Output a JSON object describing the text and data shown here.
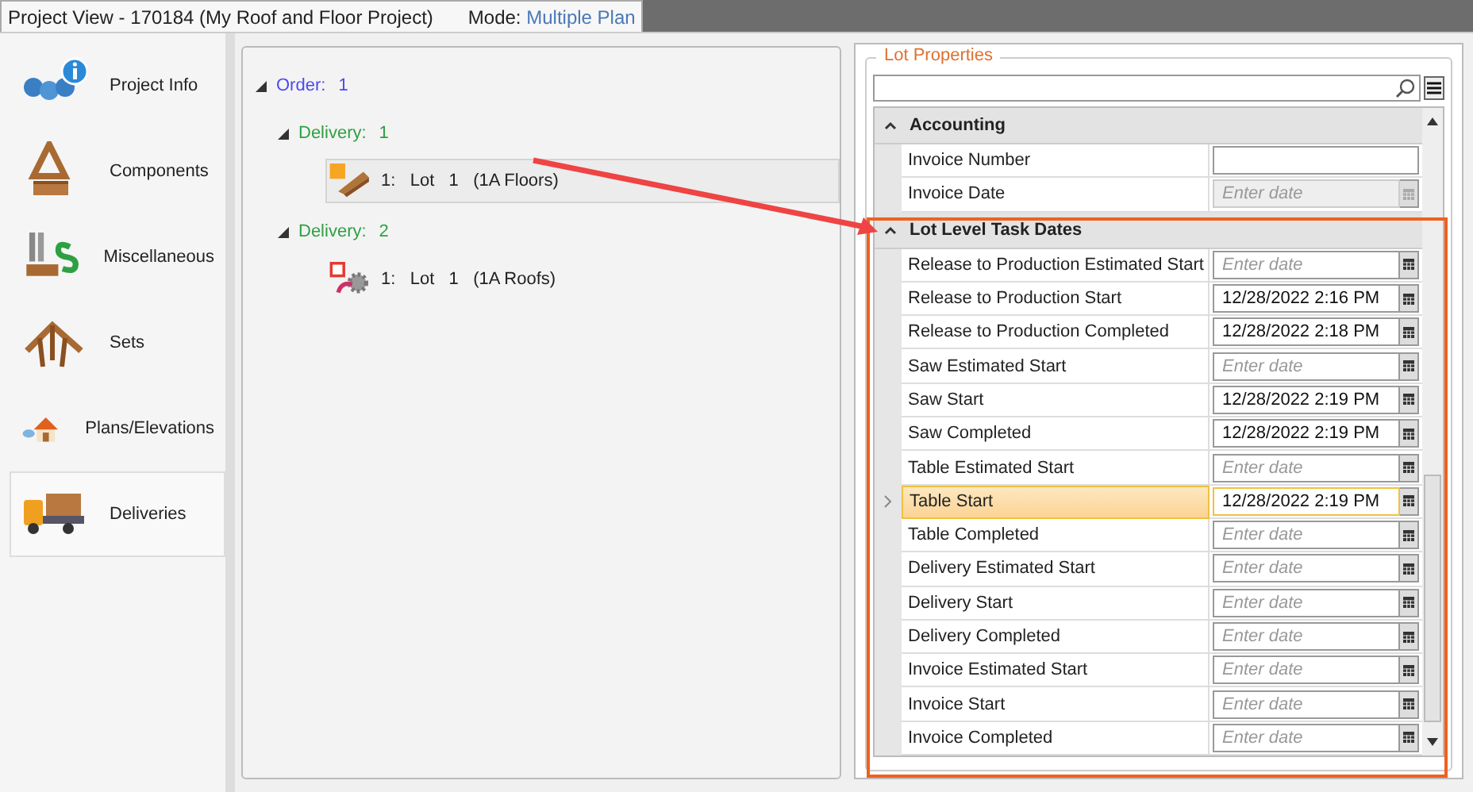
{
  "window": {
    "title": "Project View - 170184 (My Roof and Floor Project)",
    "mode_label": "Mode:",
    "mode_value": "Multiple Plan"
  },
  "nav": [
    {
      "label": "Project Info",
      "kind": "info",
      "selected": false
    },
    {
      "label": "Components",
      "kind": "truss",
      "selected": false
    },
    {
      "label": "Miscellaneous",
      "kind": "money",
      "selected": false
    },
    {
      "label": "Sets",
      "kind": "roof",
      "selected": false
    },
    {
      "label": "Plans/Elevations",
      "kind": "house",
      "selected": false
    },
    {
      "label": "Deliveries",
      "kind": "truck",
      "selected": true
    }
  ],
  "tree": [
    {
      "label": "Order:",
      "number": "1",
      "expanded": true,
      "children": [
        {
          "label": "Delivery:",
          "number": "1",
          "expanded": true,
          "children": [
            {
              "text": "1:   Lot   1   (1A Floors)",
              "kind": "floors",
              "color": "#f5a623",
              "selected": true
            }
          ]
        },
        {
          "label": "Delivery:",
          "number": "2",
          "expanded": true,
          "children": [
            {
              "text": "1:   Lot   1   (1A Roofs)",
              "kind": "roofs",
              "color": "#e53935",
              "selected": false
            }
          ]
        }
      ]
    }
  ],
  "properties": {
    "title": "Lot Properties",
    "search": {
      "kind": "search"
    },
    "sections": [
      {
        "title": "Accounting",
        "expanded": true,
        "rows": [
          {
            "label": "Invoice Number",
            "kind": "text",
            "value": "",
            "disabled": false,
            "selected": false
          },
          {
            "label": "Invoice Date",
            "kind": "date",
            "placeholder": "Enter date",
            "disabled": true,
            "selected": false
          }
        ]
      },
      {
        "title": "Lot Level Task Dates",
        "expanded": true,
        "rows": [
          {
            "label": "Release to Production Estimated Start",
            "kind": "date",
            "placeholder": "Enter date",
            "disabled": false,
            "selected": false
          },
          {
            "label": "Release to Production Start",
            "kind": "date",
            "value": "12/28/2022 2:16 PM",
            "disabled": false,
            "selected": false
          },
          {
            "label": "Release to Production Completed",
            "kind": "date",
            "value": "12/28/2022 2:18 PM",
            "disabled": false,
            "selected": false
          },
          {
            "label": "Saw Estimated Start",
            "kind": "date",
            "placeholder": "Enter date",
            "disabled": false,
            "selected": false
          },
          {
            "label": "Saw Start",
            "kind": "date",
            "value": "12/28/2022 2:19 PM",
            "disabled": false,
            "selected": false
          },
          {
            "label": "Saw Completed",
            "kind": "date",
            "value": "12/28/2022 2:19 PM",
            "disabled": false,
            "selected": false
          },
          {
            "label": "Table Estimated Start",
            "kind": "date",
            "placeholder": "Enter date",
            "disabled": false,
            "selected": false
          },
          {
            "label": "Table Start",
            "kind": "date",
            "value": "12/28/2022 2:19 PM",
            "disabled": false,
            "selected": true
          },
          {
            "label": "Table Completed",
            "kind": "date",
            "placeholder": "Enter date",
            "disabled": false,
            "selected": false
          },
          {
            "label": "Delivery Estimated Start",
            "kind": "date",
            "placeholder": "Enter date",
            "disabled": false,
            "selected": false
          },
          {
            "label": "Delivery Start",
            "kind": "date",
            "placeholder": "Enter date",
            "disabled": false,
            "selected": false
          },
          {
            "label": "Delivery Completed",
            "kind": "date",
            "placeholder": "Enter date",
            "disabled": false,
            "selected": false
          },
          {
            "label": "Invoice Estimated Start",
            "kind": "date",
            "placeholder": "Enter date",
            "disabled": false,
            "selected": false
          },
          {
            "label": "Invoice Start",
            "kind": "date",
            "placeholder": "Enter date",
            "disabled": false,
            "selected": false
          },
          {
            "label": "Invoice Completed",
            "kind": "date",
            "placeholder": "Enter date",
            "disabled": false,
            "selected": false
          }
        ]
      }
    ]
  },
  "annotations": {
    "arrow": true,
    "frame": true
  }
}
